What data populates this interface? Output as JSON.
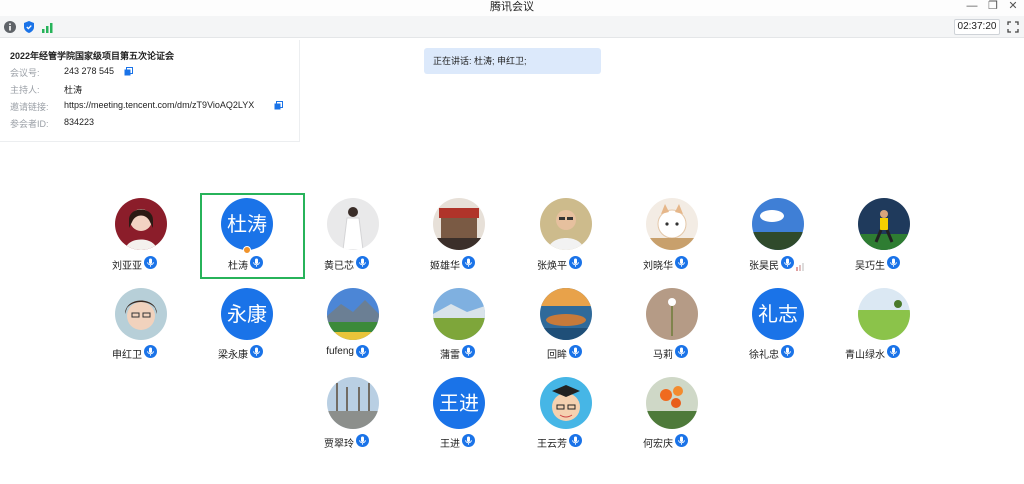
{
  "window": {
    "title": "腾讯会议"
  },
  "toolbar": {
    "icons": [
      "info-icon",
      "shield-icon",
      "signal-icon"
    ],
    "timer": "02:37:20",
    "fullscreen_icon": "fullscreen-icon"
  },
  "meeting_info": {
    "title": "2022年经管学院国家级项目第五次论证会",
    "meeting_id_label": "会议号:",
    "meeting_id": "243 278 545",
    "host_label": "主持人:",
    "host": "杜涛",
    "invite_label": "邀请链接:",
    "invite_link": "https://meeting.tencent.com/dm/zT9VioAQ2LYX",
    "participant_id_label": "参会者ID:",
    "participant_id": "834223"
  },
  "speaking": {
    "text": "正在讲话: 杜涛; 申红卫;"
  },
  "colors": {
    "accent": "#1a73e8",
    "active_border": "#27b35a",
    "speaking_bg": "#dce9fb"
  },
  "participants": [
    {
      "name": "刘亚亚",
      "avatar": "photo-woman-red",
      "speaking": false
    },
    {
      "name": "杜涛",
      "avatar_text": "杜涛",
      "host": true,
      "speaking": true
    },
    {
      "name": "黄已芯",
      "avatar": "photo-woman-white-dress",
      "speaking": false
    },
    {
      "name": "姬雄华",
      "avatar": "photo-building",
      "speaking": false
    },
    {
      "name": "张焕平",
      "avatar": "photo-man-glasses",
      "speaking": false
    },
    {
      "name": "刘晓华",
      "avatar": "photo-cat",
      "speaking": false
    },
    {
      "name": "张昊民",
      "avatar": "photo-sky-trees",
      "speaking": false,
      "signal": true
    },
    {
      "name": "吴巧生",
      "avatar": "photo-runner",
      "speaking": false
    },
    {
      "name": "申红卫",
      "avatar": "photo-woman-glasses",
      "speaking": true
    },
    {
      "name": "梁永康",
      "avatar_text": "永康",
      "speaking": false
    },
    {
      "name": "fufeng",
      "avatar": "photo-mountain-lake",
      "speaking": false
    },
    {
      "name": "蒲雷",
      "avatar": "photo-grassland",
      "speaking": false
    },
    {
      "name": "回眸",
      "avatar": "photo-lake-sunset",
      "speaking": false
    },
    {
      "name": "马莉",
      "avatar": "photo-dandelion",
      "speaking": false
    },
    {
      "name": "徐礼忠",
      "avatar_text": "礼志",
      "speaking": false
    },
    {
      "name": "青山绿水",
      "avatar": "photo-green-field",
      "speaking": false
    },
    {
      "name": "贾翠玲",
      "avatar": "photo-road-trees",
      "speaking": false
    },
    {
      "name": "王进",
      "avatar_text": "王进",
      "speaking": false
    },
    {
      "name": "王云芳",
      "avatar": "photo-cartoon-graduate",
      "speaking": false
    },
    {
      "name": "何宏庆",
      "avatar": "photo-flowers",
      "speaking": false
    }
  ]
}
